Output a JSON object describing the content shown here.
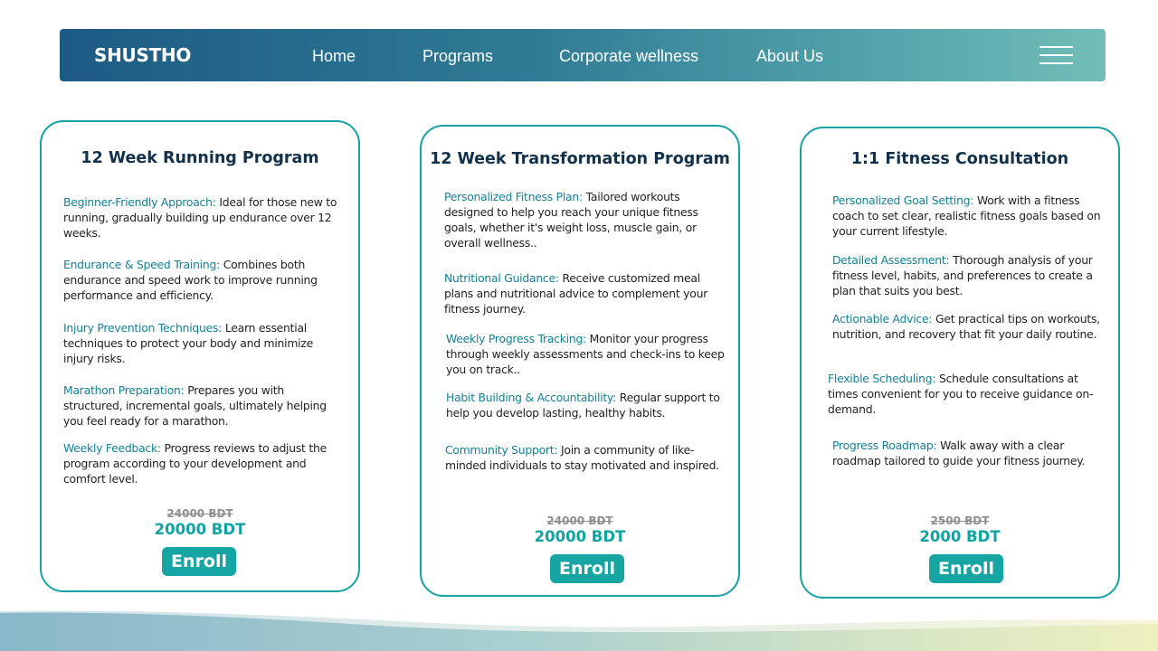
{
  "brand": {
    "logo_text": "SHUSTHO"
  },
  "nav": {
    "links": [
      "Home",
      "Programs",
      "Corporate wellness",
      "About Us"
    ],
    "menu_icon": "hamburger-menu-icon"
  },
  "colors": {
    "nav_gradient_start": "#1d5a84",
    "nav_gradient_end": "#72bdb7",
    "accent": "#17a3a3",
    "title_dark": "#12314a",
    "feature_title": "#157f95"
  },
  "cards": [
    {
      "title": "12 Week Running Program",
      "features": [
        {
          "title": "Beginner-Friendly Approach:",
          "text": " Ideal for those new to running, gradually building up endurance over 12 weeks."
        },
        {
          "title": "Endurance & Speed Training:",
          "text": " Combines both endurance and speed work to improve running performance and efficiency."
        },
        {
          "title": "Injury Prevention Techniques:",
          "text": " Learn essential techniques to protect your body and minimize injury risks."
        },
        {
          "title": "Marathon Preparation:",
          "text": " Prepares you with structured, incremental goals, ultimately helping you feel ready for a marathon."
        },
        {
          "title": "Weekly Feedback:",
          "text": " Progress reviews to adjust the program according to your development and comfort level."
        }
      ],
      "old_price": "24000 BDT",
      "price": "20000 BDT",
      "button": "Enroll"
    },
    {
      "title": "12 Week Transformation Program",
      "features": [
        {
          "title": "Personalized Fitness Plan:",
          "text": " Tailored workouts designed to help you reach your unique fitness goals, whether it's weight loss, muscle gain, or overall wellness.."
        },
        {
          "title": "Nutritional Guidance:",
          "text": " Receive customized meal plans and nutritional advice to complement your fitness journey."
        },
        {
          "title": "Weekly Progress Tracking:",
          "text": " Monitor your progress through weekly assessments and check-ins to keep you on track.."
        },
        {
          "title": "Habit Building & Accountability:",
          "text": " Regular support to help you develop lasting, healthy habits."
        },
        {
          "title": "Community Support:",
          "text": " Join a community of like-minded individuals to stay motivated and inspired."
        }
      ],
      "old_price": "24000 BDT",
      "price": "20000 BDT",
      "button": "Enroll"
    },
    {
      "title": "1:1 Fitness Consultation",
      "features": [
        {
          "title": "Personalized Goal Setting:",
          "text": " Work with a fitness coach to set clear, realistic fitness goals based on your current lifestyle."
        },
        {
          "title": "Detailed Assessment:",
          "text": " Thorough analysis of your fitness level, habits, and preferences to create a plan that suits you best."
        },
        {
          "title": "Actionable Advice:",
          "text": " Get practical tips on workouts, nutrition, and recovery that fit your daily routine."
        },
        {
          "title": "Flexible Scheduling:",
          "text": " Schedule consultations at times convenient for you to receive guidance on-demand."
        },
        {
          "title": "Progress Roadmap:",
          "text": " Walk away with a clear roadmap tailored to guide your fitness journey."
        }
      ],
      "old_price": "2500 BDT",
      "price": "2000 BDT",
      "button": "Enroll"
    }
  ]
}
